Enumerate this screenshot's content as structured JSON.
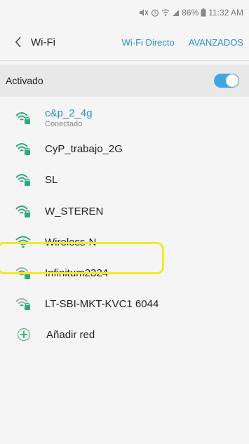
{
  "status_bar": {
    "battery": "86%",
    "time": "11:32 AM"
  },
  "header": {
    "title": "Wi-Fi",
    "action_direct": "Wi-Fi Directo",
    "action_advanced": "AVANZADOS"
  },
  "master_toggle": {
    "label": "Activado",
    "state": "on"
  },
  "networks": [
    {
      "name": "c&p_2_4g",
      "status": "Conectado",
      "secured": true
    },
    {
      "name": "CyP_trabajo_2G",
      "secured": true
    },
    {
      "name": "SL",
      "secured": true
    },
    {
      "name": "W_STEREN",
      "secured": true
    },
    {
      "name": "Wireless-N",
      "secured": false
    },
    {
      "name": "Infinitum2324",
      "secured": true
    },
    {
      "name": "LT-SBI-MKT-KVC1 6044",
      "secured": true
    }
  ],
  "add_network": {
    "label": "Añadir red"
  },
  "colors": {
    "accent": "#2a8fc7",
    "toggle_on": "#40a6e3",
    "wifi_strong": "#2eaa7a",
    "highlight": "#f2ea24",
    "add": "#42b06b"
  }
}
